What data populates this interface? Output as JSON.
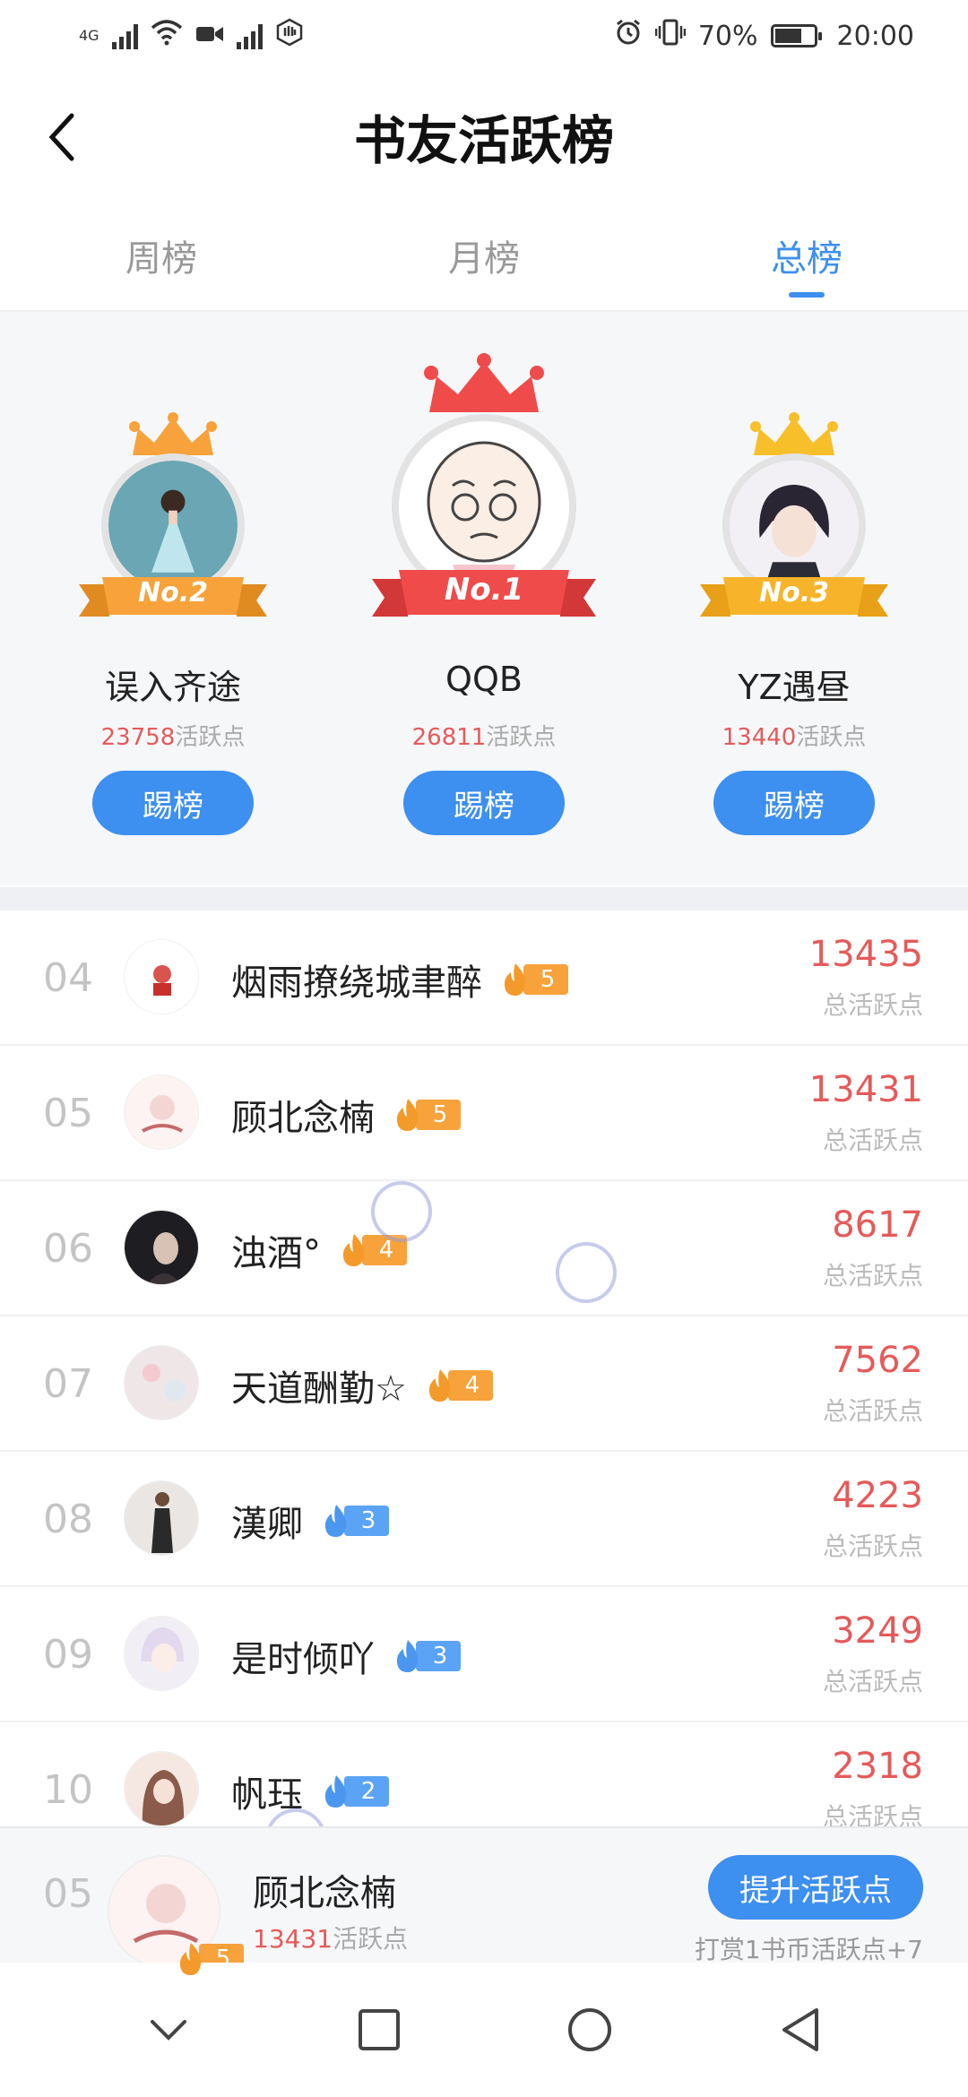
{
  "status_bar": {
    "net_label": "4G",
    "battery_text": "70%",
    "battery_level": 0.7,
    "time": "20:00",
    "icons": [
      "signal-icon",
      "wifi-icon",
      "video-icon",
      "signal2-icon",
      "hand-icon",
      "alarm-icon",
      "vibrate-icon",
      "battery-icon"
    ]
  },
  "header": {
    "title": "书友活跃榜",
    "back_icon": "chevron-left-icon"
  },
  "tabs": [
    {
      "label": "周榜",
      "active": false
    },
    {
      "label": "月榜",
      "active": false
    },
    {
      "label": "总榜",
      "active": true
    }
  ],
  "podium": [
    {
      "rank_label": "No.2",
      "name": "误入齐途",
      "points": "23758",
      "points_suffix": "活跃点",
      "button": "踢榜",
      "crown_color": "#f7a23b",
      "ribbon_color": "#f7a23b"
    },
    {
      "rank_label": "No.1",
      "name": "QQB",
      "points": "26811",
      "points_suffix": "活跃点",
      "button": "踢榜",
      "crown_color": "#ef4b4b",
      "ribbon_color": "#ef4b4b"
    },
    {
      "rank_label": "No.3",
      "name": "YZ遇昼",
      "points": "13440",
      "points_suffix": "活跃点",
      "button": "踢榜",
      "crown_color": "#f7c02a",
      "ribbon_color": "#f7b42a"
    }
  ],
  "list": [
    {
      "rank": "04",
      "name": "烟雨撩绕城聿醉",
      "level": "5",
      "level_color": "orange",
      "score": "13435",
      "score_label": "总活跃点"
    },
    {
      "rank": "05",
      "name": "顾北念楠",
      "level": "5",
      "level_color": "orange",
      "score": "13431",
      "score_label": "总活跃点"
    },
    {
      "rank": "06",
      "name": "浊酒°",
      "level": "4",
      "level_color": "orange",
      "score": "8617",
      "score_label": "总活跃点"
    },
    {
      "rank": "07",
      "name": "天道酬勤☆",
      "level": "4",
      "level_color": "orange",
      "score": "7562",
      "score_label": "总活跃点"
    },
    {
      "rank": "08",
      "name": "漢卿",
      "level": "3",
      "level_color": "blue",
      "score": "4223",
      "score_label": "总活跃点"
    },
    {
      "rank": "09",
      "name": "是时倾吖",
      "level": "3",
      "level_color": "blue",
      "score": "3249",
      "score_label": "总活跃点"
    },
    {
      "rank": "10",
      "name": "帆珏",
      "level": "2",
      "level_color": "blue",
      "score": "2318",
      "score_label": "总活跃点"
    }
  ],
  "my_rank": {
    "rank": "05",
    "name": "顾北念楠",
    "level": "5",
    "points": "13431",
    "points_suffix": "活跃点",
    "button": "提升活跃点",
    "hint": "打赏1书币活跃点+7"
  },
  "nav": [
    "chevron-down-icon",
    "square-icon",
    "circle-icon",
    "triangle-back-icon"
  ],
  "colors": {
    "accent": "#3d8ff0",
    "score_red": "#e55a5a",
    "level_orange": "#f7a23b",
    "level_blue": "#5aa3f5"
  }
}
